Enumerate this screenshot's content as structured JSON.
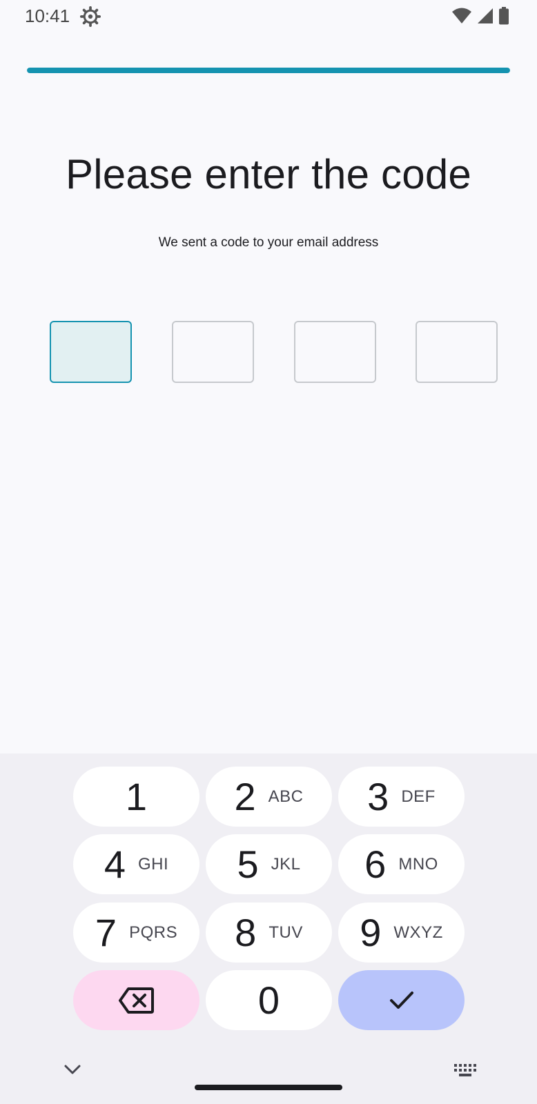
{
  "status_bar": {
    "time": "10:41",
    "icons": [
      "settings-gear-icon",
      "wifi-icon",
      "cellular-signal-icon",
      "battery-icon"
    ]
  },
  "progress": {
    "value": 1.0,
    "color": "#1593b0"
  },
  "title": "Please enter the code",
  "subtitle": "We sent a code to your email address",
  "code_inputs": [
    {
      "value": "",
      "active": true
    },
    {
      "value": "",
      "active": false
    },
    {
      "value": "",
      "active": false
    },
    {
      "value": "",
      "active": false
    }
  ],
  "keyboard": {
    "keys": [
      {
        "num": "1",
        "letters": ""
      },
      {
        "num": "2",
        "letters": "ABC"
      },
      {
        "num": "3",
        "letters": "DEF"
      },
      {
        "num": "4",
        "letters": "GHI"
      },
      {
        "num": "5",
        "letters": "JKL"
      },
      {
        "num": "6",
        "letters": "MNO"
      },
      {
        "num": "7",
        "letters": "PQRS"
      },
      {
        "num": "8",
        "letters": "TUV"
      },
      {
        "num": "9",
        "letters": "WXYZ"
      },
      {
        "num": "0",
        "letters": ""
      }
    ],
    "backspace_icon": "backspace-icon",
    "done_icon": "checkmark-icon",
    "collapse_icon": "chevron-down-icon",
    "switch_icon": "keyboard-icon"
  },
  "colors": {
    "accent": "#1593b0",
    "backspace_key": "#fdd8f0",
    "done_key": "#b8c4fb",
    "keyboard_bg": "#f0eff4"
  }
}
